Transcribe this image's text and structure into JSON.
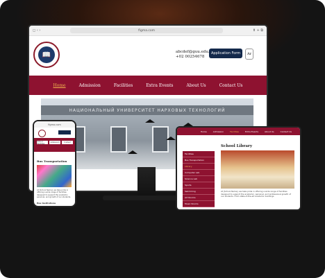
{
  "browser": {
    "url": "figma.com"
  },
  "desktop": {
    "email": "abcdef@guu.edu.eg",
    "phone": "+02 00254678",
    "apply_label": "Application Form",
    "lang_label": "Ar",
    "nav": [
      "Home",
      "Admission",
      "Facilities",
      "Extra Events",
      "About Us",
      "Contact Us"
    ],
    "hero_sign": "НАЦИОНАЛЬНЫЙ УНИВЕРСИТЕТ НАРХОВЫХ ТЕХНОЛОГИЙ"
  },
  "phone": {
    "tabs": [
      "School Facilities",
      "Admission",
      "Contact"
    ],
    "section_title": "Bus Transportation",
    "body": "At [School Name], we take pride in offering a wide range of facilities designed to support the academic, personal, and growth of our students.",
    "footer_title": "Bus Institutions"
  },
  "tablet": {
    "nav": [
      "Home",
      "Admission",
      "Facilities",
      "Extra Events",
      "About Us",
      "Contact Us"
    ],
    "sidebar": [
      "Facilities",
      "Bus Transportation",
      "Library",
      "Computer Lab",
      "Science Lab",
      "Sports",
      "Swimming",
      "Art Rooms",
      "Music Rooms"
    ],
    "title": "School Library",
    "body": "At [School Name], we take pride in offering a wide range of facilities designed to support the academic, personal, and professional growth of our students. From state-of-the-art academic buildings"
  }
}
